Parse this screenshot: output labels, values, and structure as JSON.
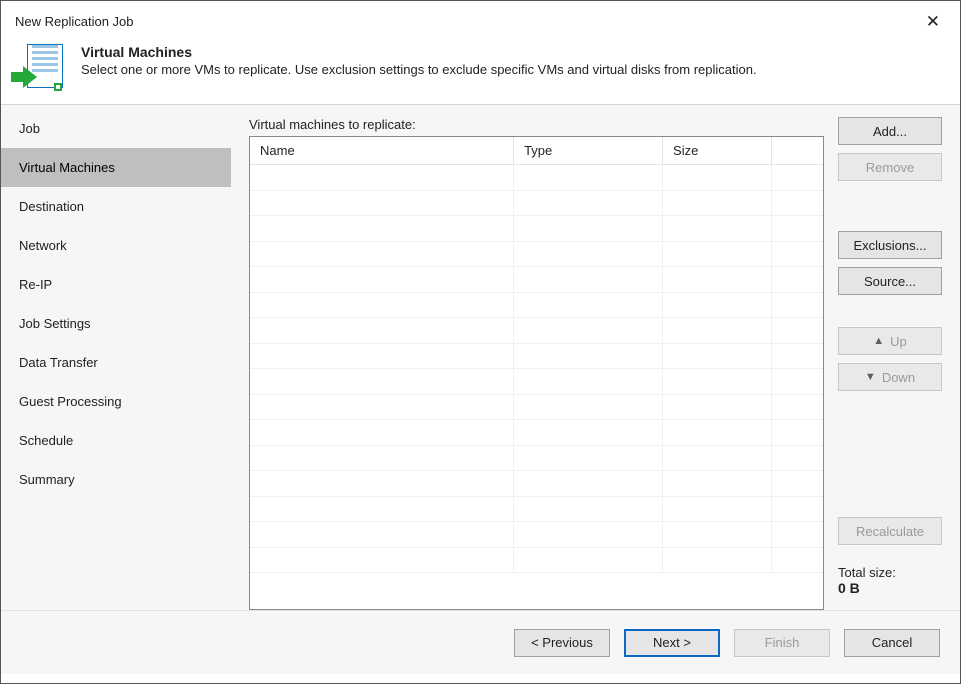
{
  "window": {
    "title": "New Replication Job"
  },
  "header": {
    "title": "Virtual Machines",
    "desc": "Select one or more VMs to replicate. Use exclusion settings to exclude specific VMs and virtual disks from replication."
  },
  "sidebar": {
    "items": [
      {
        "label": "Job"
      },
      {
        "label": "Virtual Machines"
      },
      {
        "label": "Destination"
      },
      {
        "label": "Network"
      },
      {
        "label": "Re-IP"
      },
      {
        "label": "Job Settings"
      },
      {
        "label": "Data Transfer"
      },
      {
        "label": "Guest Processing"
      },
      {
        "label": "Schedule"
      },
      {
        "label": "Summary"
      }
    ],
    "activeIndex": 1
  },
  "main": {
    "label": "Virtual machines to replicate:",
    "columns": {
      "name": "Name",
      "type": "Type",
      "size": "Size"
    },
    "rows": []
  },
  "buttons": {
    "add": "Add...",
    "remove": "Remove",
    "exclusions": "Exclusions...",
    "source": "Source...",
    "up": "Up",
    "down": "Down",
    "recalculate": "Recalculate"
  },
  "total": {
    "label": "Total size:",
    "value": "0 B"
  },
  "footer": {
    "previous": "< Previous",
    "next": "Next >",
    "finish": "Finish",
    "cancel": "Cancel"
  }
}
